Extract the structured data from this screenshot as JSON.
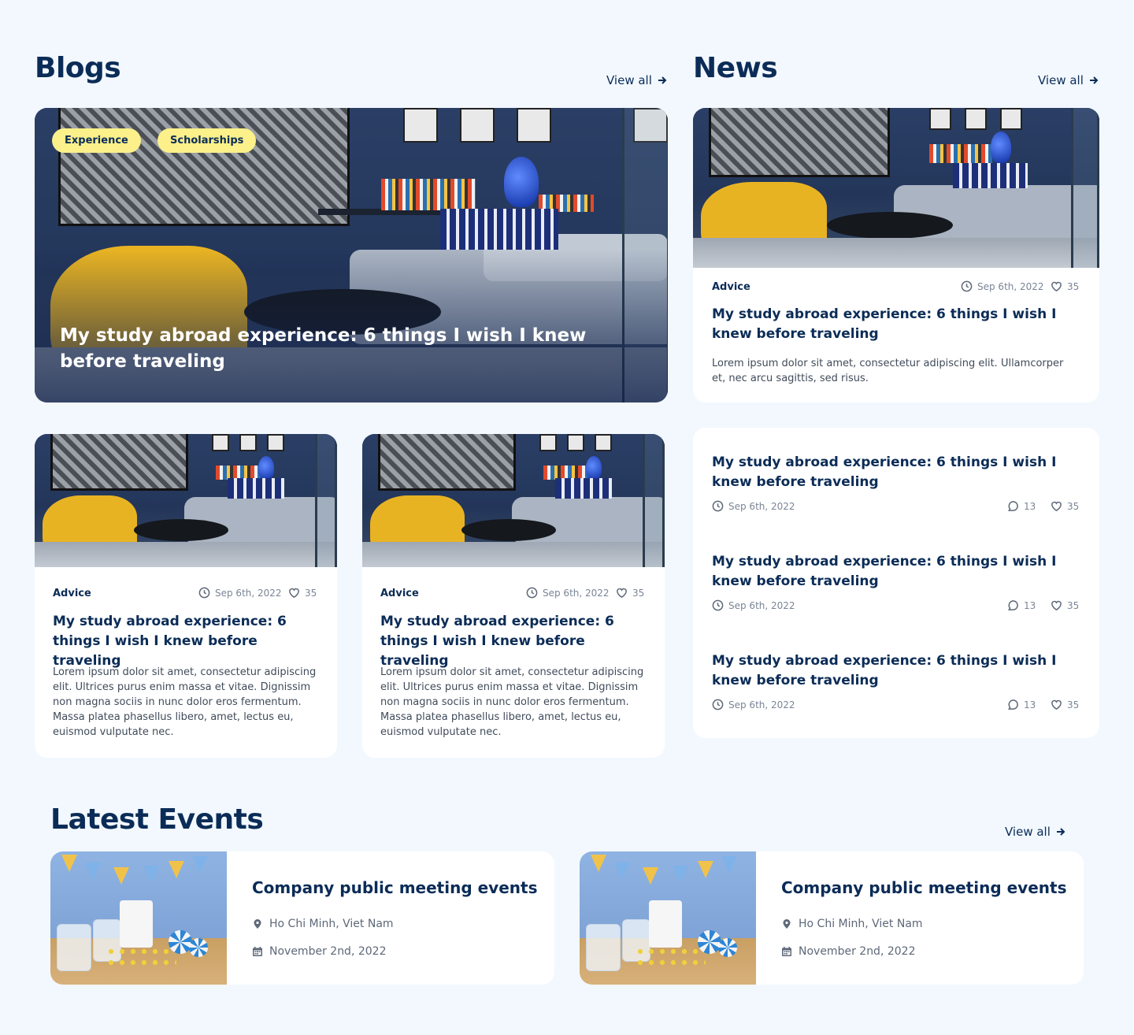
{
  "blogs": {
    "title": "Blogs",
    "view_all": "View all",
    "featured": {
      "tags": [
        "Experience",
        "Scholarships"
      ],
      "title": "My study abroad experience: 6 things I wish I knew before traveling"
    },
    "cards": [
      {
        "category": "Advice",
        "date": "Sep 6th, 2022",
        "likes": "35",
        "title": "My study abroad experience: 6 things I wish I knew before traveling",
        "excerpt": "Lorem ipsum dolor sit amet, consectetur adipiscing elit. Ultrices purus enim massa et vitae. Dignissim non magna sociis in nunc dolor eros fermentum. Massa platea phasellus libero, amet, lectus eu, euismod vulputate nec."
      },
      {
        "category": "Advice",
        "date": "Sep 6th, 2022",
        "likes": "35",
        "title": "My study abroad experience: 6 things I wish I knew before traveling",
        "excerpt": "Lorem ipsum dolor sit amet, consectetur adipiscing elit. Ultrices purus enim massa et vitae. Dignissim non magna sociis in nunc dolor eros fermentum. Massa platea phasellus libero, amet, lectus eu, euismod vulputate nec."
      }
    ]
  },
  "news": {
    "title": "News",
    "view_all": "View all",
    "featured": {
      "category": "Advice",
      "date": "Sep 6th, 2022",
      "likes": "35",
      "title": "My study abroad experience: 6 things I wish I knew before traveling",
      "excerpt": "Lorem ipsum dolor sit amet, consectetur adipiscing elit. Ullamcorper et, nec arcu sagittis, sed risus."
    },
    "list": [
      {
        "title": "My study abroad experience: 6 things I wish I knew before traveling",
        "date": "Sep 6th, 2022",
        "comments": "13",
        "likes": "35"
      },
      {
        "title": "My study abroad experience: 6 things I wish I knew before traveling",
        "date": "Sep 6th, 2022",
        "comments": "13",
        "likes": "35"
      },
      {
        "title": "My study abroad experience: 6 things I wish I knew before traveling",
        "date": "Sep 6th, 2022",
        "comments": "13",
        "likes": "35"
      }
    ]
  },
  "events": {
    "title": "Latest Events",
    "view_all": "View all",
    "items": [
      {
        "title": "Company public meeting events",
        "location": "Ho Chi Minh, Viet Nam",
        "date": "November 2nd, 2022"
      },
      {
        "title": "Company public meeting events",
        "location": "Ho Chi Minh, Viet Nam",
        "date": "November 2nd, 2022"
      }
    ]
  },
  "icons": {
    "view_all": "arrow-right-icon",
    "date": "clock-icon",
    "likes": "heart-icon",
    "comments": "comment-icon",
    "location": "map-pin-icon",
    "event_date": "calendar-icon"
  },
  "colors": {
    "background": "#f2f8fe",
    "primary_text": "#0b2c57",
    "tag_background": "#fbf089",
    "card_background": "#ffffff",
    "meta_text": "#7a8596"
  }
}
